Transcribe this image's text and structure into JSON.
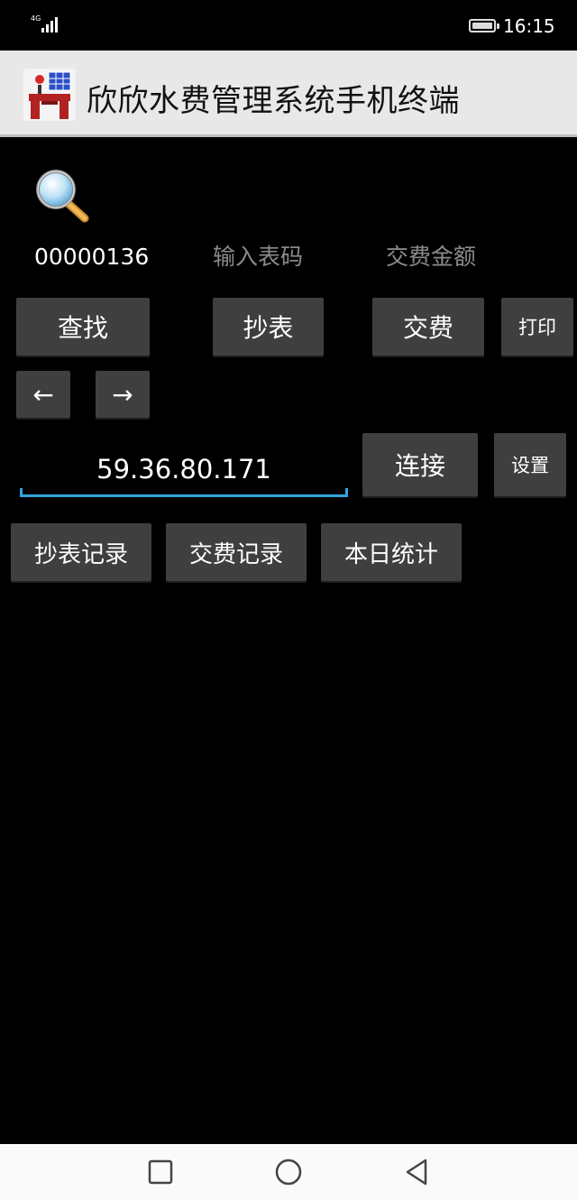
{
  "status_bar": {
    "network": "4G",
    "time": "16:15"
  },
  "app": {
    "title": "欣欣水费管理系统手机终端"
  },
  "fields": {
    "user_number": "00000136",
    "meter_reading_placeholder": "输入表码",
    "payment_amount_placeholder": "交费金额",
    "server_ip": "59.36.80.171"
  },
  "buttons": {
    "find": "查找",
    "read_meter": "抄表",
    "pay": "交费",
    "print": "打印",
    "prev": "←",
    "next": "→",
    "connect": "连接",
    "settings": "设置",
    "read_records": "抄表记录",
    "pay_records": "交费记录",
    "today_stats": "本日统计"
  },
  "colors": {
    "accent_underline": "#33a3dc",
    "button_bg": "#3f3f3f",
    "titlebar_bg": "#e8e8e8"
  }
}
